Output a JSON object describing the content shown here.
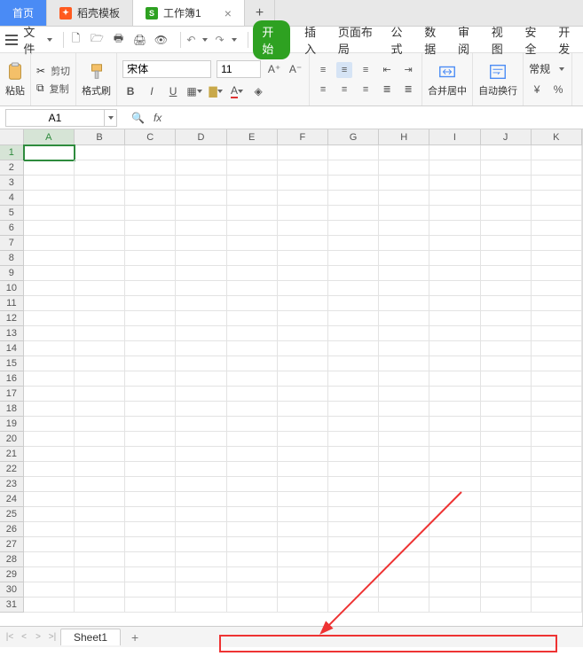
{
  "tabs": {
    "home": "首页",
    "templates": "稻壳模板",
    "workbook": "工作簿1"
  },
  "menu": {
    "file": "文件"
  },
  "ribbon_tabs": {
    "start": "开始",
    "insert": "插入",
    "layout": "页面布局",
    "formulas": "公式",
    "data": "数据",
    "review": "审阅",
    "view": "视图",
    "security": "安全",
    "dev": "开发"
  },
  "ribbon": {
    "paste": "粘贴",
    "cut": "剪切",
    "copy": "复制",
    "format_painter": "格式刷",
    "font_name": "宋体",
    "font_size": "11",
    "merge_center": "合并居中",
    "wrap_text": "自动换行",
    "general": "常规"
  },
  "namebox": "A1",
  "columns": [
    "A",
    "B",
    "C",
    "D",
    "E",
    "F",
    "G",
    "H",
    "I",
    "J",
    "K"
  ],
  "row_count": 31,
  "sheetbar": {
    "sheet1": "Sheet1"
  },
  "active_cell": {
    "row": 1,
    "col": "A"
  }
}
